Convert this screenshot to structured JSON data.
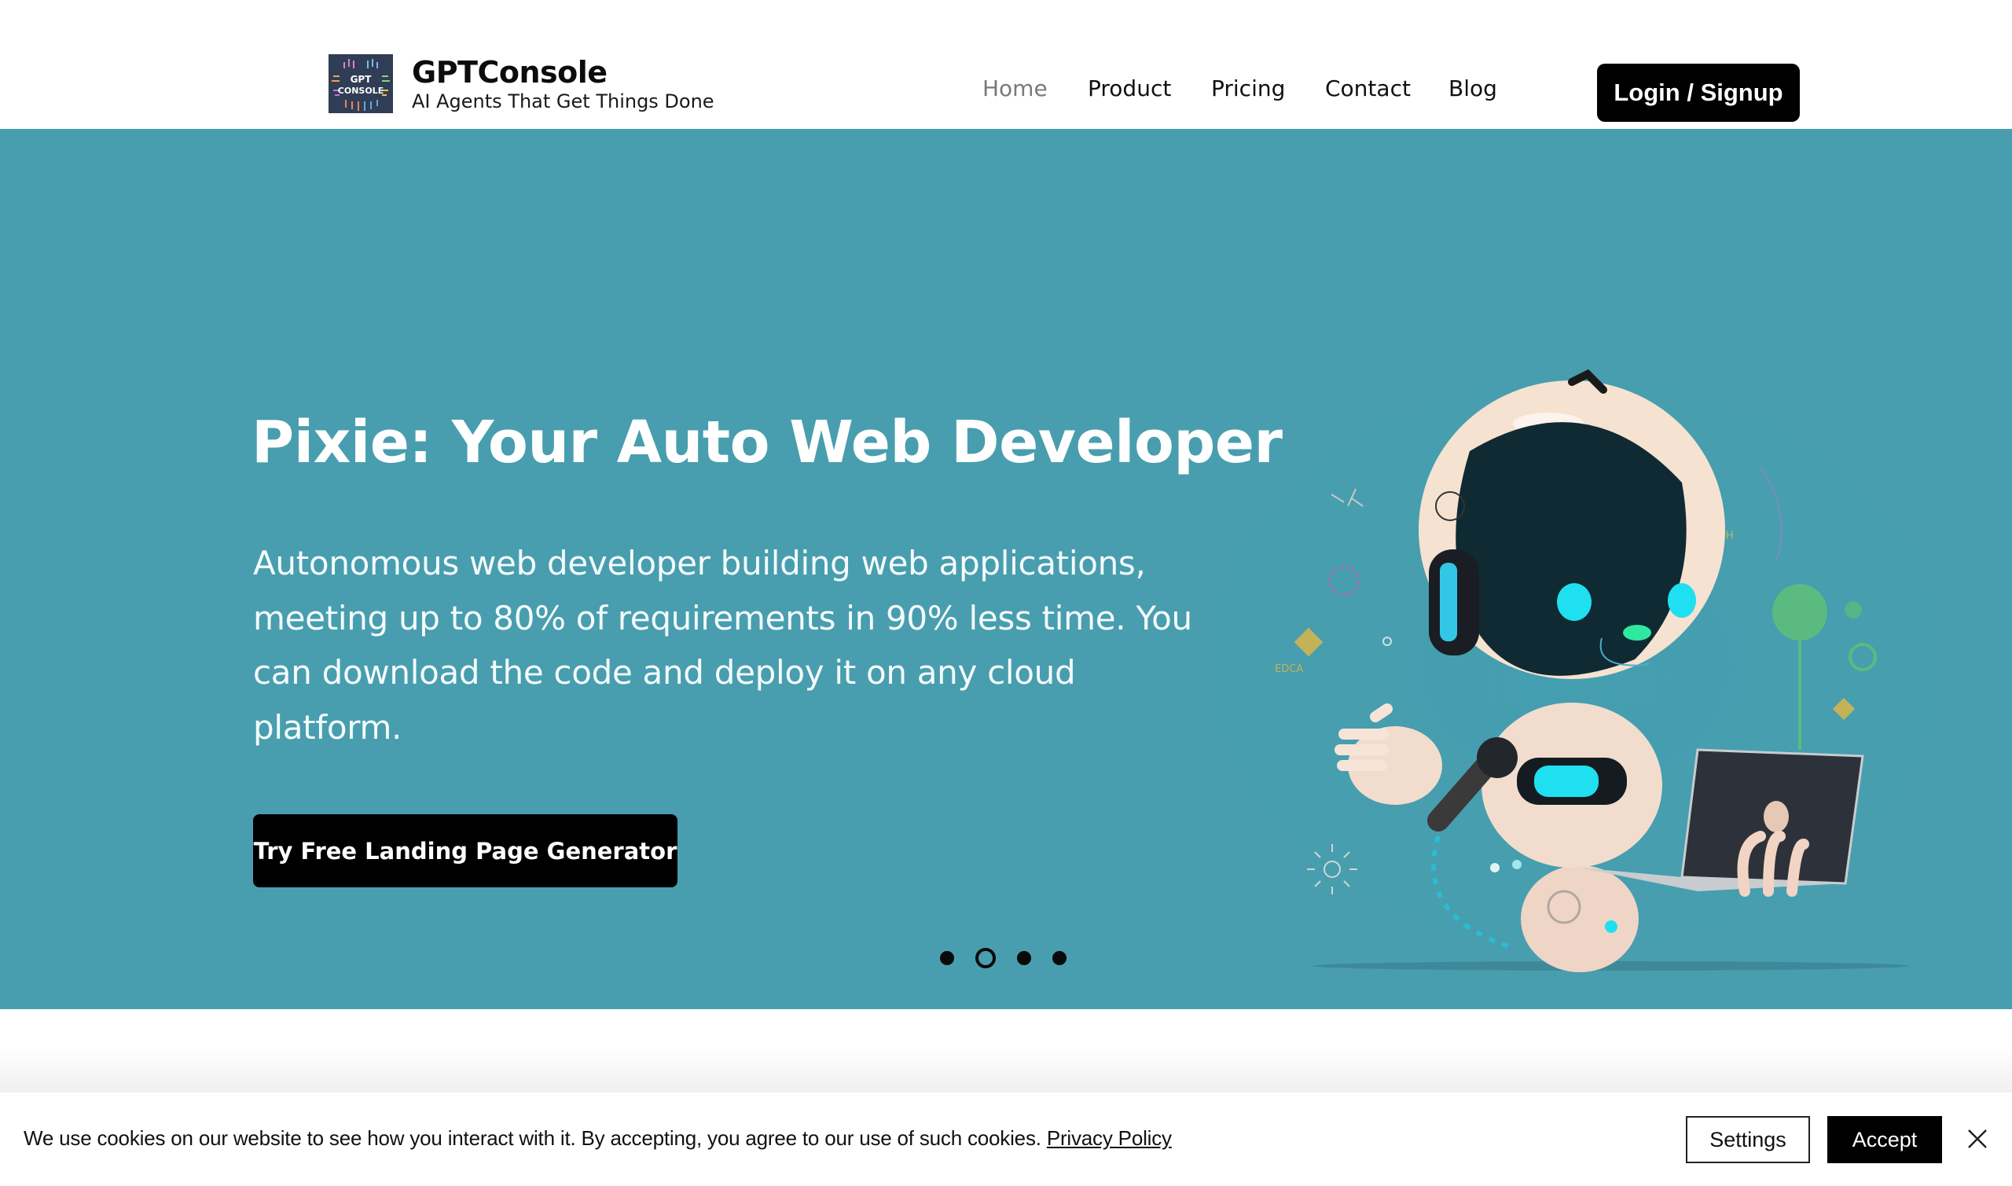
{
  "header": {
    "logo_alt": "GPT CONSOLE",
    "logo_icon": "circuit-logo-icon",
    "brand": "GPTConsole",
    "tagline": "AI Agents That Get Things Done",
    "nav": [
      {
        "label": "Home",
        "active": true
      },
      {
        "label": "Product",
        "active": false
      },
      {
        "label": "Pricing",
        "active": false
      },
      {
        "label": "Contact",
        "active": false
      },
      {
        "label": "Blog",
        "active": false
      }
    ],
    "login_label": "Login / Signup"
  },
  "hero": {
    "title": "Pixie: Your Auto Web Developer",
    "description": "Autonomous web developer building web applications, meeting up to 80% of requirements in 90% less time. You can download the code and deploy it on any cloud platform.",
    "cta_label": "Try Free Landing Page Generator",
    "illustration": "robot-with-laptop-illustration",
    "carousel": {
      "total": 4,
      "active_index": 1
    }
  },
  "colors": {
    "hero_bg": "#489eae",
    "button_bg": "#000000",
    "nav_active": "#7a7a7a",
    "robot_eye": "#1fe0f0",
    "robot_nose": "#2ee8a0"
  },
  "cookie_banner": {
    "text": "We use cookies on our website to see how you interact with it. By accepting, you agree to our use of such cookies.",
    "link_label": "Privacy Policy",
    "settings_label": "Settings",
    "accept_label": "Accept",
    "close_icon": "close-icon"
  }
}
